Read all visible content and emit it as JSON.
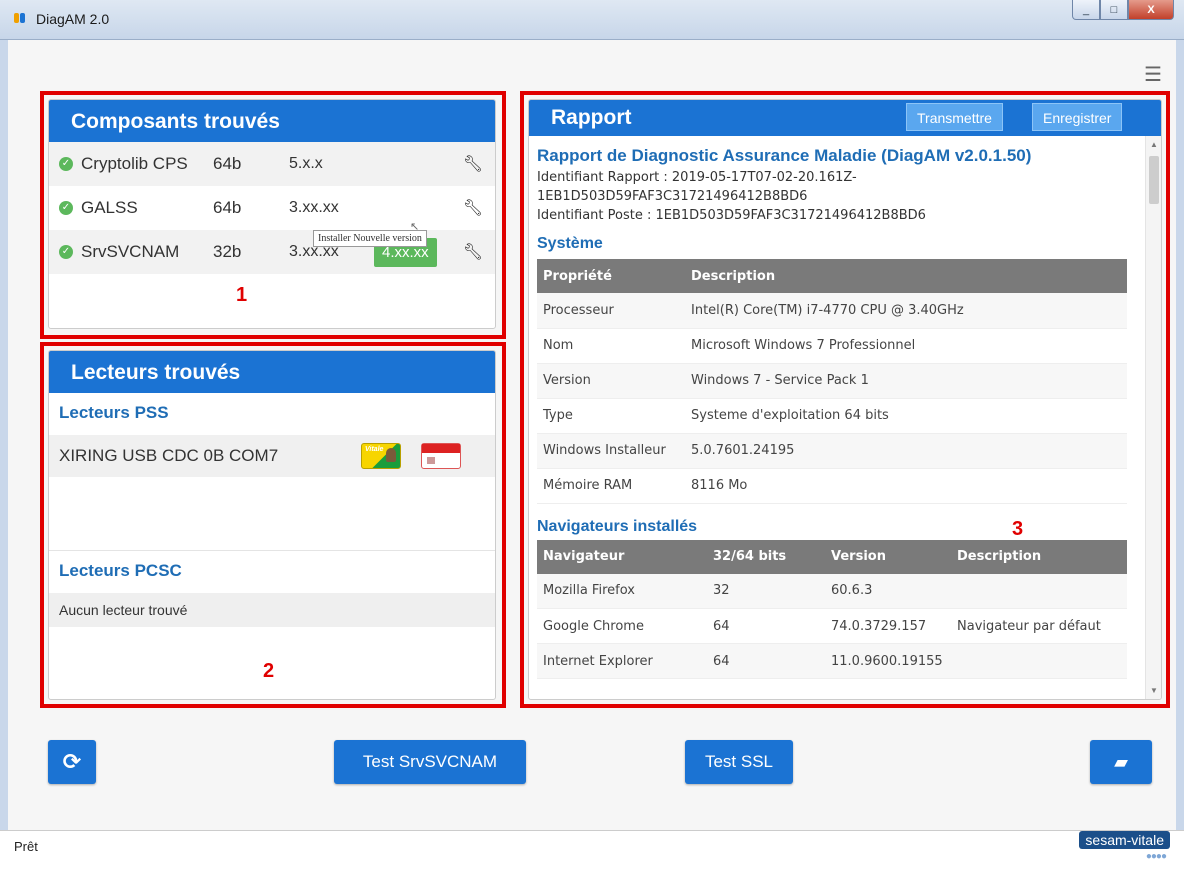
{
  "window": {
    "title": "DiagAM 2.0",
    "controls": {
      "minimize": "_",
      "maximize": "□",
      "close": "X"
    }
  },
  "menu_icon": "☰",
  "labels": {
    "one": "1",
    "two": "2",
    "three": "3"
  },
  "composants": {
    "title": "Composants trouvés",
    "rows": [
      {
        "name": "Cryptolib CPS",
        "arch": "64b",
        "version": "5.x.x"
      },
      {
        "name": "GALSS",
        "arch": "64b",
        "version": "3.xx.xx"
      },
      {
        "name": "SrvSVCNAM",
        "arch": "32b",
        "version": "3.xx.xx",
        "new_version": "4.xx.xx"
      }
    ],
    "tooltip": "Installer Nouvelle version"
  },
  "lecteurs": {
    "title": "Lecteurs trouvés",
    "pss_title": "Lecteurs PSS",
    "pss_reader": "XIRING USB CDC 0B COM7",
    "vitale_label": "Vitale",
    "pcsc_title": "Lecteurs PCSC",
    "pcsc_empty": "Aucun lecteur trouvé"
  },
  "rapport": {
    "title": "Rapport",
    "btn_transmettre": "Transmettre",
    "btn_enregistrer": "Enregistrer",
    "heading": "Rapport de Diagnostic Assurance Maladie (DiagAM v2.0.1.50)",
    "id_rapport_1": "Identifiant Rapport : 2019-05-17T07-02-20.161Z-",
    "id_rapport_2": "1EB1D503D59FAF3C31721496412B8BD6",
    "id_poste": "Identifiant Poste : 1EB1D503D59FAF3C31721496412B8BD6",
    "systeme_title": "Système",
    "systeme_headers": {
      "prop": "Propriété",
      "desc": "Description"
    },
    "systeme_rows": [
      {
        "prop": "Processeur",
        "desc": "Intel(R) Core(TM) i7-4770 CPU @ 3.40GHz"
      },
      {
        "prop": "Nom",
        "desc": "Microsoft Windows 7 Professionnel"
      },
      {
        "prop": "Version",
        "desc": "Windows 7 - Service Pack 1"
      },
      {
        "prop": "Type",
        "desc": "Systeme d'exploitation 64 bits"
      },
      {
        "prop": "Windows Installeur",
        "desc": "5.0.7601.24195"
      },
      {
        "prop": "Mémoire RAM",
        "desc": "8116 Mo"
      }
    ],
    "nav_title": "Navigateurs installés",
    "nav_headers": {
      "nav": "Navigateur",
      "bits": "32/64 bits",
      "ver": "Version",
      "desc": "Description"
    },
    "nav_rows": [
      {
        "nav": "Mozilla Firefox",
        "bits": "32",
        "ver": "60.6.3",
        "desc": ""
      },
      {
        "nav": "Google Chrome",
        "bits": "64",
        "ver": "74.0.3729.157",
        "desc": "Navigateur par défaut"
      },
      {
        "nav": "Internet Explorer",
        "bits": "64",
        "ver": "11.0.9600.19155",
        "desc": ""
      }
    ]
  },
  "buttons": {
    "refresh": "⟳",
    "test_srv": "Test SrvSVCNAM",
    "test_ssl": "Test SSL",
    "folder": "▰"
  },
  "status": {
    "text": "Prêt",
    "brand": "sesam-vitale",
    "brand_dots": "●●●●"
  },
  "colors": {
    "accent": "#1b73d3",
    "success": "#5cb85c",
    "highlight": "#e00000"
  }
}
